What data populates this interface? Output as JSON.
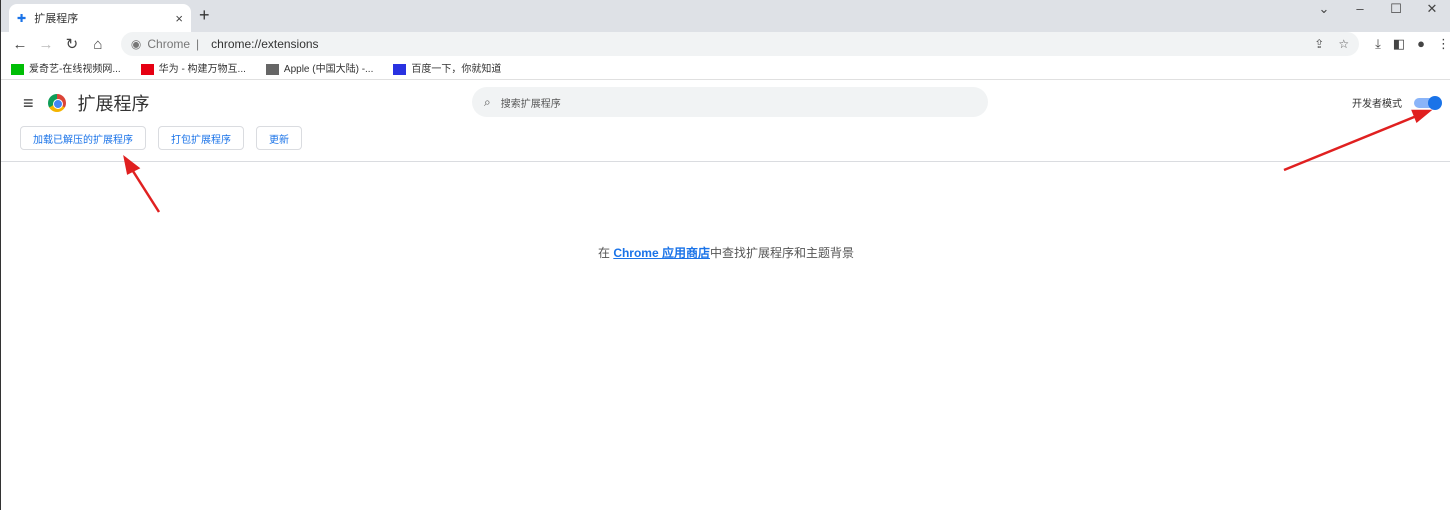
{
  "tab": {
    "title": "扩展程序",
    "close": "×"
  },
  "new_tab": "+",
  "window": {
    "chevron": "⌄",
    "min": "–",
    "max": "☐",
    "close": "✕"
  },
  "omnibox": {
    "site": "Chrome",
    "url": "chrome://extensions"
  },
  "bookmarks": [
    {
      "label": "爱奇艺-在线视频网...",
      "color": "#00be06"
    },
    {
      "label": "华为 - 构建万物互...",
      "color": "#e60012"
    },
    {
      "label": "Apple (中国大陆) -...",
      "color": "#666666"
    },
    {
      "label": "百度一下，你就知道",
      "color": "#2932e1"
    }
  ],
  "header": {
    "title": "扩展程序",
    "search_placeholder": "搜索扩展程序",
    "dev_mode_label": "开发者模式",
    "dev_mode_on": true
  },
  "buttons": {
    "load_unpacked": "加载已解压的扩展程序",
    "pack": "打包扩展程序",
    "update": "更新"
  },
  "empty": {
    "prefix": "在 ",
    "link": "Chrome 应用商店",
    "suffix": "中查找扩展程序和主题背景"
  },
  "colors": {
    "accent": "#1a73e8",
    "annotation": "#e02020"
  }
}
